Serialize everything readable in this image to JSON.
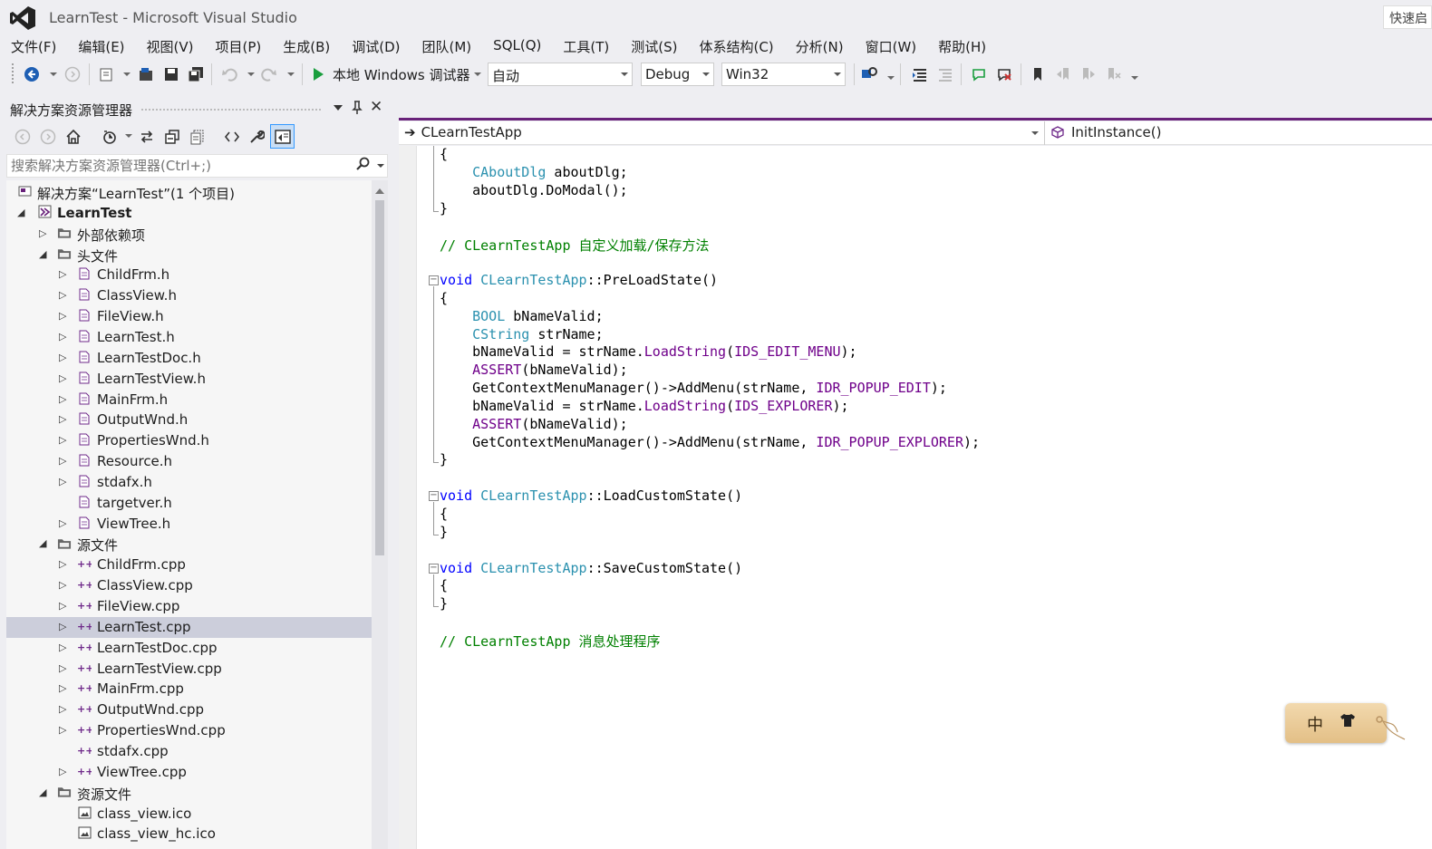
{
  "window": {
    "title": "LearnTest - Microsoft Visual Studio",
    "quick_launch": "快速启"
  },
  "menu": [
    "文件(F)",
    "编辑(E)",
    "视图(V)",
    "项目(P)",
    "生成(B)",
    "调试(D)",
    "团队(M)",
    "SQL(Q)",
    "工具(T)",
    "测试(S)",
    "体系结构(C)",
    "分析(N)",
    "窗口(W)",
    "帮助(H)"
  ],
  "toolbar": {
    "run_label": "本地 Windows 调试器",
    "combo_auto": "自动",
    "combo_config": "Debug",
    "combo_platform": "Win32"
  },
  "solution_explorer": {
    "title": "解决方案资源管理器",
    "search_placeholder": "搜索解决方案资源管理器(Ctrl+;)",
    "tree": [
      {
        "label": "解决方案“LearnTest”(1 个项目)",
        "level": 0,
        "expander": "",
        "icon": "solution",
        "bold": false
      },
      {
        "label": "LearnTest",
        "level": 0,
        "expander": "open",
        "icon": "project",
        "bold": true
      },
      {
        "label": "外部依赖项",
        "level": 1,
        "expander": "closed",
        "icon": "folder",
        "bold": false
      },
      {
        "label": "头文件",
        "level": 1,
        "expander": "open",
        "icon": "folder",
        "bold": false
      },
      {
        "label": "ChildFrm.h",
        "level": 2,
        "expander": "closed",
        "icon": "header",
        "bold": false
      },
      {
        "label": "ClassView.h",
        "level": 2,
        "expander": "closed",
        "icon": "header",
        "bold": false
      },
      {
        "label": "FileView.h",
        "level": 2,
        "expander": "closed",
        "icon": "header",
        "bold": false
      },
      {
        "label": "LearnTest.h",
        "level": 2,
        "expander": "closed",
        "icon": "header",
        "bold": false
      },
      {
        "label": "LearnTestDoc.h",
        "level": 2,
        "expander": "closed",
        "icon": "header",
        "bold": false
      },
      {
        "label": "LearnTestView.h",
        "level": 2,
        "expander": "closed",
        "icon": "header",
        "bold": false
      },
      {
        "label": "MainFrm.h",
        "level": 2,
        "expander": "closed",
        "icon": "header",
        "bold": false
      },
      {
        "label": "OutputWnd.h",
        "level": 2,
        "expander": "closed",
        "icon": "header",
        "bold": false
      },
      {
        "label": "PropertiesWnd.h",
        "level": 2,
        "expander": "closed",
        "icon": "header",
        "bold": false
      },
      {
        "label": "Resource.h",
        "level": 2,
        "expander": "closed",
        "icon": "header",
        "bold": false
      },
      {
        "label": "stdafx.h",
        "level": 2,
        "expander": "closed",
        "icon": "header",
        "bold": false
      },
      {
        "label": "targetver.h",
        "level": 2,
        "expander": "",
        "icon": "header",
        "bold": false
      },
      {
        "label": "ViewTree.h",
        "level": 2,
        "expander": "closed",
        "icon": "header",
        "bold": false
      },
      {
        "label": "源文件",
        "level": 1,
        "expander": "open",
        "icon": "folder",
        "bold": false
      },
      {
        "label": "ChildFrm.cpp",
        "level": 2,
        "expander": "closed",
        "icon": "cpp",
        "bold": false
      },
      {
        "label": "ClassView.cpp",
        "level": 2,
        "expander": "closed",
        "icon": "cpp",
        "bold": false
      },
      {
        "label": "FileView.cpp",
        "level": 2,
        "expander": "closed",
        "icon": "cpp",
        "bold": false
      },
      {
        "label": "LearnTest.cpp",
        "level": 2,
        "expander": "closed",
        "icon": "cpp",
        "bold": false,
        "selected": true
      },
      {
        "label": "LearnTestDoc.cpp",
        "level": 2,
        "expander": "closed",
        "icon": "cpp",
        "bold": false
      },
      {
        "label": "LearnTestView.cpp",
        "level": 2,
        "expander": "closed",
        "icon": "cpp",
        "bold": false
      },
      {
        "label": "MainFrm.cpp",
        "level": 2,
        "expander": "closed",
        "icon": "cpp",
        "bold": false
      },
      {
        "label": "OutputWnd.cpp",
        "level": 2,
        "expander": "closed",
        "icon": "cpp",
        "bold": false
      },
      {
        "label": "PropertiesWnd.cpp",
        "level": 2,
        "expander": "closed",
        "icon": "cpp",
        "bold": false
      },
      {
        "label": "stdafx.cpp",
        "level": 2,
        "expander": "",
        "icon": "cpp",
        "bold": false
      },
      {
        "label": "ViewTree.cpp",
        "level": 2,
        "expander": "closed",
        "icon": "cpp",
        "bold": false
      },
      {
        "label": "资源文件",
        "level": 1,
        "expander": "open",
        "icon": "folder",
        "bold": false
      },
      {
        "label": "class_view.ico",
        "level": 2,
        "expander": "",
        "icon": "image",
        "bold": false
      },
      {
        "label": "class_view_hc.ico",
        "level": 2,
        "expander": "",
        "icon": "image",
        "bold": false
      }
    ]
  },
  "editor": {
    "nav_class": "CLearnTestApp",
    "nav_member": "InitInstance()",
    "lines": [
      [
        {
          "t": "{"
        }
      ],
      [
        {
          "t": "    "
        },
        {
          "t": "CAboutDlg",
          "c": "type"
        },
        {
          "t": " aboutDlg;"
        }
      ],
      [
        {
          "t": "    aboutDlg.DoModal();"
        }
      ],
      [
        {
          "t": "}"
        }
      ],
      [],
      [
        {
          "t": "// CLearnTestApp 自定义加载/保存方法",
          "c": "cmt"
        }
      ],
      [],
      [
        {
          "t": "void",
          "c": "kw"
        },
        {
          "t": " "
        },
        {
          "t": "CLearnTestApp",
          "c": "type"
        },
        {
          "t": "::PreLoadState()"
        }
      ],
      [
        {
          "t": "{"
        }
      ],
      [
        {
          "t": "    "
        },
        {
          "t": "BOOL",
          "c": "type"
        },
        {
          "t": " bNameValid;"
        }
      ],
      [
        {
          "t": "    "
        },
        {
          "t": "CString",
          "c": "type"
        },
        {
          "t": " strName;"
        }
      ],
      [
        {
          "t": "    bNameValid = strName."
        },
        {
          "t": "LoadString",
          "c": "macro"
        },
        {
          "t": "("
        },
        {
          "t": "IDS_EDIT_MENU",
          "c": "macro"
        },
        {
          "t": ");"
        }
      ],
      [
        {
          "t": "    "
        },
        {
          "t": "ASSERT",
          "c": "macro"
        },
        {
          "t": "(bNameValid);"
        }
      ],
      [
        {
          "t": "    GetContextMenuManager()->AddMenu(strName, "
        },
        {
          "t": "IDR_POPUP_EDIT",
          "c": "macro"
        },
        {
          "t": ");"
        }
      ],
      [
        {
          "t": "    bNameValid = strName."
        },
        {
          "t": "LoadString",
          "c": "macro"
        },
        {
          "t": "("
        },
        {
          "t": "IDS_EXPLORER",
          "c": "macro"
        },
        {
          "t": ");"
        }
      ],
      [
        {
          "t": "    "
        },
        {
          "t": "ASSERT",
          "c": "macro"
        },
        {
          "t": "(bNameValid);"
        }
      ],
      [
        {
          "t": "    GetContextMenuManager()->AddMenu(strName, "
        },
        {
          "t": "IDR_POPUP_EXPLORER",
          "c": "macro"
        },
        {
          "t": ");"
        }
      ],
      [
        {
          "t": "}"
        }
      ],
      [],
      [
        {
          "t": "void",
          "c": "kw"
        },
        {
          "t": " "
        },
        {
          "t": "CLearnTestApp",
          "c": "type"
        },
        {
          "t": "::LoadCustomState()"
        }
      ],
      [
        {
          "t": "{"
        }
      ],
      [
        {
          "t": "}"
        }
      ],
      [],
      [
        {
          "t": "void",
          "c": "kw"
        },
        {
          "t": " "
        },
        {
          "t": "CLearnTestApp",
          "c": "type"
        },
        {
          "t": "::SaveCustomState()"
        }
      ],
      [
        {
          "t": "{"
        }
      ],
      [
        {
          "t": "}"
        }
      ],
      [],
      [
        {
          "t": "// CLearnTestApp 消息处理程序",
          "c": "cmt"
        }
      ]
    ]
  },
  "ime": {
    "label": "中"
  },
  "colors": {
    "accent": "#68217a",
    "keyword": "#0000ff",
    "type": "#2b91af",
    "macro": "#6f008a",
    "comment": "#008000",
    "selected_row": "#cccedb"
  }
}
